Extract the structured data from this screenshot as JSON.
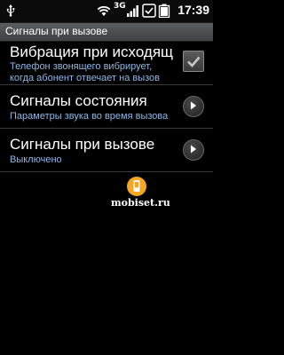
{
  "status_bar": {
    "network": "3G",
    "time": "17:39"
  },
  "title_bar": {
    "title": "Сигналы при вызове"
  },
  "list": {
    "items": [
      {
        "title": "Вибрация при исходящ",
        "subtitle_line1": "Телефон звонящего вибрирует,",
        "subtitle_line2": "когда абонент отвечает на вызов",
        "control": "checkbox",
        "checked": true
      },
      {
        "title": "Сигналы состояния",
        "subtitle_line1": "Параметры звука во время вызова",
        "control": "chevron-right"
      },
      {
        "title": "Сигналы при вызове",
        "subtitle_line1": "Выключено",
        "control": "chevron-right"
      }
    ]
  },
  "watermark": {
    "text": "mobiset.ru"
  },
  "colors": {
    "subtitle": "#8fb6e4",
    "title_bar": "#4a4d50",
    "watermark_accent": "#f5a623"
  }
}
